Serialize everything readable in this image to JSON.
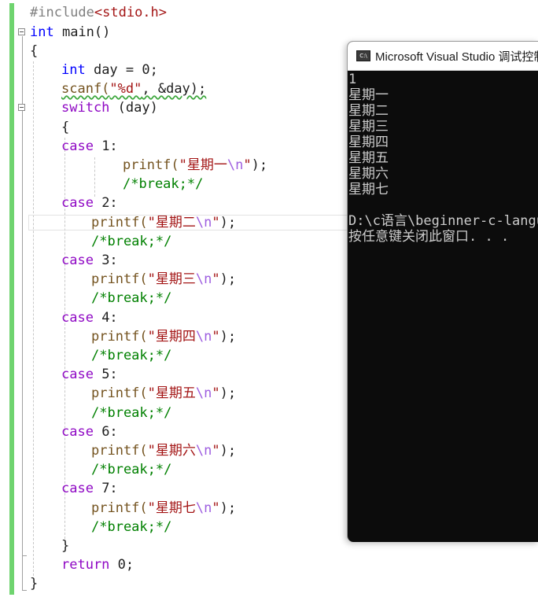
{
  "editor": {
    "lines": {
      "l1": {
        "a": "#include",
        "b": "<stdio.h>"
      },
      "l2": {
        "a": "int",
        "b": " main()"
      },
      "l3": {
        "a": "{"
      },
      "l4": {
        "a": "int",
        "b": " day = 0;"
      },
      "l5": {
        "a": "scanf(",
        "b": "\"%d\"",
        "c": ", &day);"
      },
      "l6": {
        "a": "switch",
        "b": " (day)"
      },
      "l7": {
        "a": "{"
      },
      "c1": {
        "a": "case",
        "b": " 1:"
      },
      "p1": {
        "a": "printf(",
        "b": "\"星期一",
        "c": "\\n",
        "d": "\"",
        "e": ");"
      },
      "k1": {
        "a": "/*break;*/"
      },
      "c2": {
        "a": "case",
        "b": " 2:"
      },
      "p2": {
        "a": "printf(",
        "b": "\"星期二",
        "c": "\\n",
        "d": "\"",
        "e": ");"
      },
      "k2": {
        "a": "/*break;*/"
      },
      "c3": {
        "a": "case",
        "b": " 3:"
      },
      "p3": {
        "a": "printf(",
        "b": "\"星期三",
        "c": "\\n",
        "d": "\"",
        "e": ");"
      },
      "k3": {
        "a": "/*break;*/"
      },
      "c4": {
        "a": "case",
        "b": " 4:"
      },
      "p4": {
        "a": "printf(",
        "b": "\"星期四",
        "c": "\\n",
        "d": "\"",
        "e": ");"
      },
      "k4": {
        "a": "/*break;*/"
      },
      "c5": {
        "a": "case",
        "b": " 5:"
      },
      "p5": {
        "a": "printf(",
        "b": "\"星期五",
        "c": "\\n",
        "d": "\"",
        "e": ");"
      },
      "k5": {
        "a": "/*break;*/"
      },
      "c6": {
        "a": "case",
        "b": " 6:"
      },
      "p6": {
        "a": "printf(",
        "b": "\"星期六",
        "c": "\\n",
        "d": "\"",
        "e": ");"
      },
      "k6": {
        "a": "/*break;*/"
      },
      "c7": {
        "a": "case",
        "b": " 7:"
      },
      "p7": {
        "a": "printf(",
        "b": "\"星期七",
        "c": "\\n",
        "d": "\"",
        "e": ");"
      },
      "k7": {
        "a": "/*break;*/"
      },
      "l8": {
        "a": "}"
      },
      "l9": {
        "a": "return",
        "b": " 0;"
      },
      "l10": {
        "a": "}"
      }
    }
  },
  "console": {
    "title": "Microsoft Visual Studio 调试控制台",
    "icon": "console-app-icon",
    "icon_text": "C:\\",
    "output": [
      "1",
      "星期一",
      "星期二",
      "星期三",
      "星期四",
      "星期五",
      "星期六",
      "星期七",
      "",
      "D:\\c语言\\beginner-c-language",
      "按任意键关闭此窗口. . ."
    ]
  },
  "colors": {
    "keyword": "#0000ff",
    "control": "#8f08c4",
    "function": "#74531f",
    "string": "#a31515",
    "comment": "#008000",
    "console_bg": "#0c0c0c",
    "console_fg": "#cccccc",
    "change_bar": "#6fd46f"
  }
}
